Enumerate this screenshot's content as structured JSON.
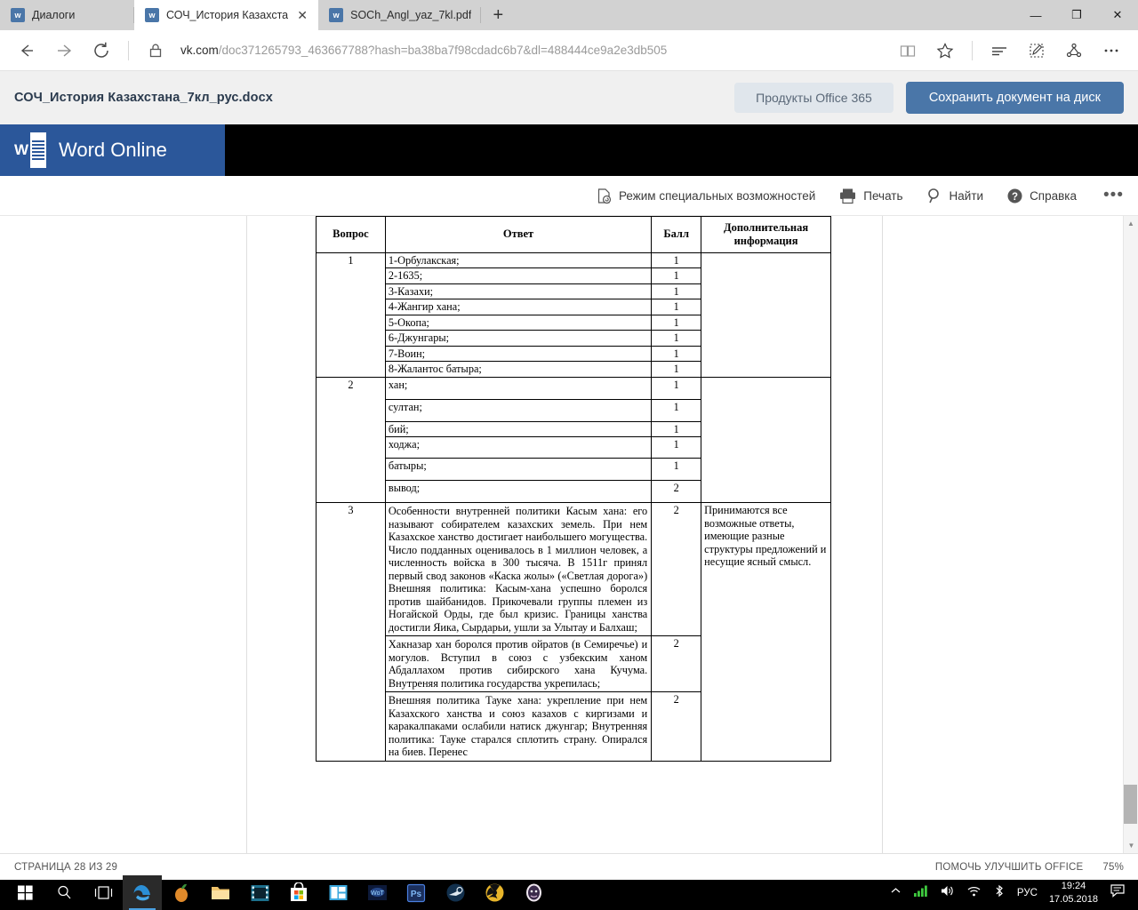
{
  "browser": {
    "tabs": [
      {
        "title": "Диалоги",
        "favicon": "vk-icon",
        "active": false,
        "closable": false
      },
      {
        "title": "СОЧ_История Казахста",
        "favicon": "vk-icon",
        "active": true,
        "closable": true
      },
      {
        "title": "SOCh_Angl_yaz_7kl.pdf",
        "favicon": "vk-icon",
        "active": false,
        "closable": false
      }
    ],
    "new_tab_label": "+",
    "window_controls": {
      "minimize": "—",
      "maximize": "❐",
      "close": "✕"
    },
    "nav": {
      "back": "back-arrow-icon",
      "forward": "forward-arrow-icon",
      "refresh": "refresh-icon",
      "lock": "lock-icon"
    },
    "url": {
      "host": "vk.com",
      "path": "/doc371265793_463667788?hash=ba38ba7f98cdadc6b7&dl=488444ce9a2e3db505",
      "full": "vk.com/doc371265793_463667788?hash=ba38ba7f98cdadc6b7&dl=488444ce9a2e3db505"
    },
    "toolbar_right": [
      "reading-view-icon",
      "favorites-star-icon",
      "hub-icon",
      "web-note-icon",
      "share-icon",
      "more-icon"
    ]
  },
  "filebar": {
    "filename": "СОЧ_История Казахстана_7кл_рус.docx",
    "office_button": "Продукты Office 365",
    "save_button": "Сохранить документ на диск"
  },
  "word": {
    "brand": "Word Online",
    "toolbar": [
      {
        "label": "Режим специальных возможностей",
        "icon": "accessibility-icon"
      },
      {
        "label": "Печать",
        "icon": "printer-icon"
      },
      {
        "label": "Найти",
        "icon": "search-icon"
      },
      {
        "label": "Справка",
        "icon": "help-icon"
      }
    ],
    "more_label": "•••"
  },
  "document": {
    "table": {
      "headers": [
        "Вопрос",
        "Ответ",
        "Балл",
        "Дополнительная информация"
      ],
      "groups": [
        {
          "question": "1",
          "rows": [
            {
              "answer": "1-Орбулакская;",
              "score": "1",
              "info": ""
            },
            {
              "answer": "2-1635;",
              "score": "1",
              "info": ""
            },
            {
              "answer": "3-Казахи;",
              "score": "1",
              "info": ""
            },
            {
              "answer": "4-Жангир хана;",
              "score": "1",
              "info": ""
            },
            {
              "answer": "5-Окопа;",
              "score": "1",
              "info": ""
            },
            {
              "answer": "6-Джунгары;",
              "score": "1",
              "info": ""
            },
            {
              "answer": "7-Воин;",
              "score": "1",
              "info": ""
            },
            {
              "answer": "8-Жалантос батыра;",
              "score": "1",
              "info": ""
            }
          ]
        },
        {
          "question": "2",
          "rows": [
            {
              "answer": "хан;",
              "score": "1",
              "info": ""
            },
            {
              "answer": "султан;",
              "score": "1",
              "info": ""
            },
            {
              "answer": "бий;",
              "score": "1",
              "info": ""
            },
            {
              "answer": "ходжа;",
              "score": "1",
              "info": ""
            },
            {
              "answer": "батыры;",
              "score": "1",
              "info": ""
            },
            {
              "answer": "вывод;",
              "score": "2",
              "info": ""
            }
          ]
        },
        {
          "question": "3",
          "rows": [
            {
              "answer": "Особенности внутренней политики Касым хана: его называют собирателем казахских земель. При нем Казахское ханство достигает наибольшего могущества. Число подданных оценивалось в 1 миллион человек, а численность войска в 300 тысяча. В 1511г принял первый свод законов «Каска жолы» («Светлая дорога»)\nВнешняя политика: Касым-хана успешно боролся против шайбанидов. Прикочевали группы племен из Ногайской Орды, где был кризис. Границы ханства достигли Яика, Сырдарьи, ушли за Улытау и Балхаш;",
              "score": "2",
              "info": "Принимаются все возможные ответы, имеющие разные структуры предложений и несущие ясный смысл."
            },
            {
              "answer": "Хакназар хан боролся против ойратов (в Семиречье) и могулов. Вступил в союз с узбекским ханом Абдаллахом против сибирского хана Кучума. Внутреняя политика государства укрепилась;",
              "score": "2",
              "info": ""
            },
            {
              "answer": "Внешняя политика Тауке хана: укрепление при нем Казахского ханства и союз казахов с киргизами и каракалпаками ослабили натиск джунгар;\nВнутренняя политика: Тауке старался сплотить страну. Опирался на биев. Перенес",
              "score": "2",
              "info": ""
            }
          ]
        }
      ]
    }
  },
  "statusbar": {
    "page_info": "СТРАНИЦА 28 ИЗ 29",
    "improve_office": "ПОМОЧЬ УЛУЧШИТЬ OFFICE",
    "zoom": "75%"
  },
  "taskbar": {
    "start": "windows-start-icon",
    "search": "search-icon",
    "taskview": "task-view-icon",
    "apps": [
      {
        "name": "edge-icon",
        "active": true
      },
      {
        "name": "fl-studio-icon",
        "active": false
      },
      {
        "name": "file-explorer-icon",
        "active": false
      },
      {
        "name": "movie-maker-icon",
        "active": false
      },
      {
        "name": "microsoft-store-icon",
        "active": false
      },
      {
        "name": "powerpoint-icon",
        "active": false
      },
      {
        "name": "game-icon",
        "active": false
      },
      {
        "name": "photoshop-icon",
        "active": false
      },
      {
        "name": "steam-icon",
        "active": false
      },
      {
        "name": "radiation-icon",
        "active": false
      },
      {
        "name": "avatar-app-icon",
        "active": false
      }
    ],
    "tray": {
      "chevron": "show-hidden-icons",
      "network_signal": "signal-bars-icon",
      "volume": "volume-icon",
      "wifi": "wifi-icon",
      "bluetooth": "bluetooth-icon",
      "language": "РУС",
      "time": "19:24",
      "date": "17.05.2018",
      "notifications": "action-center-icon"
    }
  },
  "colors": {
    "vk_blue": "#4a76a8",
    "word_blue": "#2b579a",
    "taskbar_black": "#000000",
    "filebar_gray": "#f0f0f0"
  }
}
